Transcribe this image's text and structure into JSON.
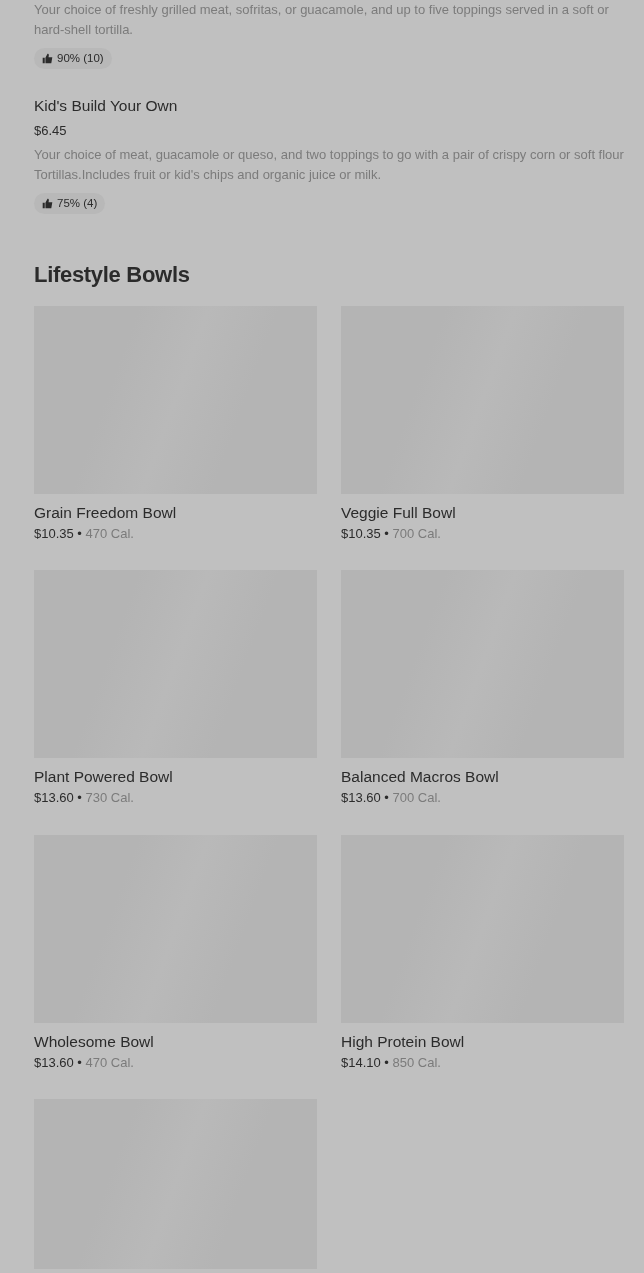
{
  "menu_items": [
    {
      "description": "Your choice of freshly grilled meat, sofritas, or guacamole, and up to five toppings served in a soft or hard-shell tortilla.",
      "rating": "90% (10)"
    },
    {
      "title": "Kid's Build Your Own",
      "price": "$6.45",
      "description": "Your choice of meat, guacamole or queso, and two toppings to go with a pair of crispy corn or soft flour Tortillas.Includes fruit or kid's chips and organic juice or milk.",
      "rating": "75% (4)"
    }
  ],
  "section": {
    "title": "Lifestyle Bowls",
    "items": [
      {
        "kind": "full",
        "name": "Grain Freedom Bowl",
        "price": "$10.35",
        "separator": "•",
        "calories": "470 Cal."
      },
      {
        "kind": "full",
        "name": "Veggie Full Bowl",
        "price": "$10.35",
        "separator": "•",
        "calories": "700 Cal."
      },
      {
        "kind": "full",
        "name": "Plant Powered Bowl",
        "price": "$13.60",
        "separator": "•",
        "calories": "730 Cal."
      },
      {
        "kind": "full",
        "name": "Balanced Macros Bowl",
        "price": "$13.60",
        "separator": "•",
        "calories": "700 Cal."
      },
      {
        "kind": "full",
        "name": "Wholesome Bowl",
        "price": "$13.60",
        "separator": "•",
        "calories": "470 Cal."
      },
      {
        "kind": "full",
        "name": "High Protein Bowl",
        "price": "$14.10",
        "separator": "•",
        "calories": "850 Cal."
      },
      {
        "kind": "image_only"
      }
    ]
  }
}
